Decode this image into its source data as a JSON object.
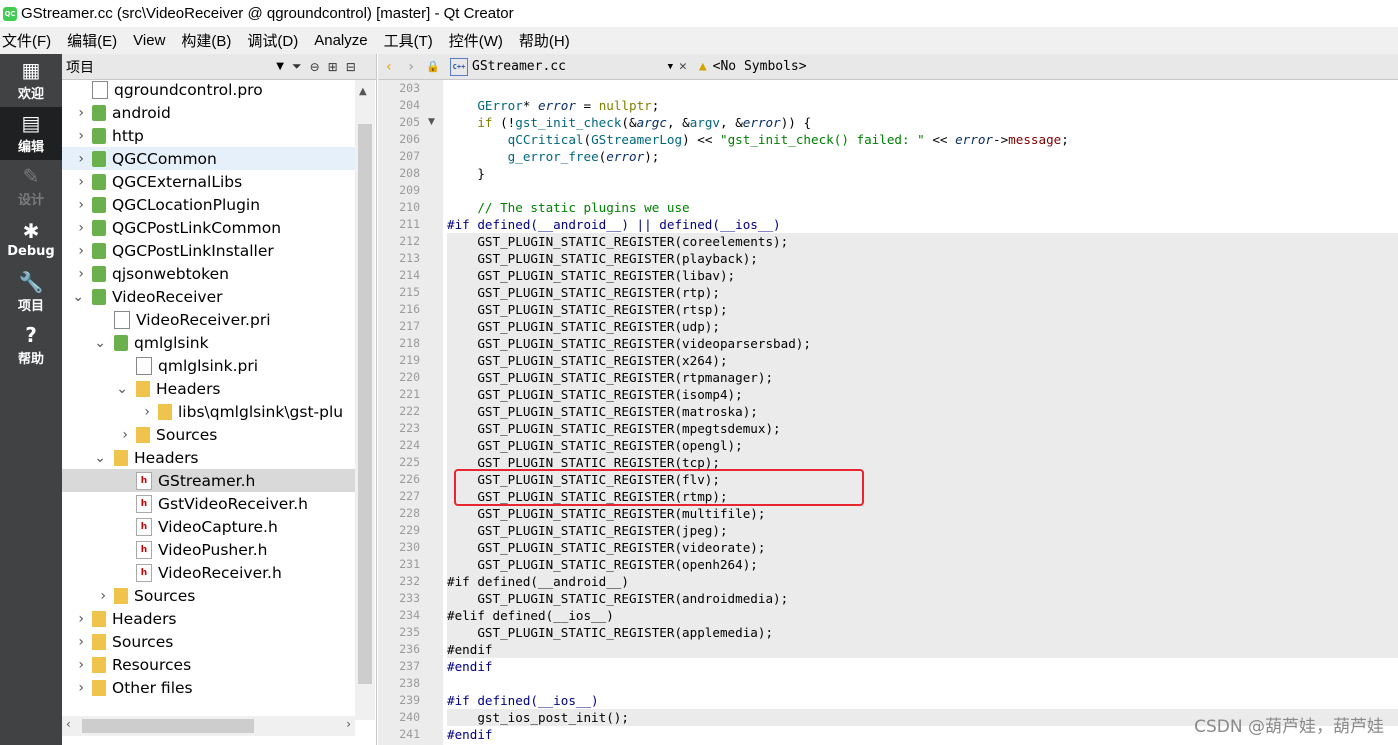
{
  "window": {
    "title": "GStreamer.cc (src\\VideoReceiver @ qgroundcontrol) [master] - Qt Creator",
    "app_icon": "QC"
  },
  "menu": [
    "文件(F)",
    "编辑(E)",
    "View",
    "构建(B)",
    "调试(D)",
    "Analyze",
    "工具(T)",
    "控件(W)",
    "帮助(H)"
  ],
  "modes": [
    {
      "label": "欢迎",
      "icon": "grid-icon",
      "glyph": "▦"
    },
    {
      "label": "编辑",
      "icon": "document-icon",
      "glyph": "▤"
    },
    {
      "label": "设计",
      "icon": "pen-icon",
      "glyph": "✎"
    },
    {
      "label": "Debug",
      "icon": "bug-icon",
      "glyph": "✱"
    },
    {
      "label": "项目",
      "icon": "wrench-icon",
      "glyph": "🔧"
    },
    {
      "label": "帮助",
      "icon": "help-icon",
      "glyph": "?"
    }
  ],
  "project_pane": {
    "title": "项目"
  },
  "tree": [
    {
      "label": "qgroundcontrol.pro",
      "indent": 0,
      "arrow": "",
      "icon": "pro"
    },
    {
      "label": "android",
      "indent": 0,
      "arrow": "›",
      "icon": "proj"
    },
    {
      "label": "http",
      "indent": 0,
      "arrow": "›",
      "icon": "proj"
    },
    {
      "label": "QGCCommon",
      "indent": 0,
      "arrow": "›",
      "icon": "proj",
      "sel": "light"
    },
    {
      "label": "QGCExternalLibs",
      "indent": 0,
      "arrow": "›",
      "icon": "proj"
    },
    {
      "label": "QGCLocationPlugin",
      "indent": 0,
      "arrow": "›",
      "icon": "proj"
    },
    {
      "label": "QGCPostLinkCommon",
      "indent": 0,
      "arrow": "›",
      "icon": "proj"
    },
    {
      "label": "QGCPostLinkInstaller",
      "indent": 0,
      "arrow": "›",
      "icon": "proj"
    },
    {
      "label": "qjsonwebtoken",
      "indent": 0,
      "arrow": "›",
      "icon": "proj"
    },
    {
      "label": "VideoReceiver",
      "indent": 0,
      "arrow": "⌄",
      "icon": "proj"
    },
    {
      "label": "VideoReceiver.pri",
      "indent": 1,
      "arrow": "",
      "icon": "pro"
    },
    {
      "label": "qmlglsink",
      "indent": 1,
      "arrow": "⌄",
      "icon": "proj"
    },
    {
      "label": "qmlglsink.pri",
      "indent": 2,
      "arrow": "",
      "icon": "pro"
    },
    {
      "label": "Headers",
      "indent": 2,
      "arrow": "⌄",
      "icon": "folder"
    },
    {
      "label": "libs\\qmlglsink\\gst-plu",
      "indent": 3,
      "arrow": "›",
      "icon": "folder"
    },
    {
      "label": "Sources",
      "indent": 2,
      "arrow": "›",
      "icon": "folder"
    },
    {
      "label": "Headers",
      "indent": 1,
      "arrow": "⌄",
      "icon": "folder"
    },
    {
      "label": "GStreamer.h",
      "indent": 2,
      "arrow": "",
      "icon": "h",
      "sel": "gray"
    },
    {
      "label": "GstVideoReceiver.h",
      "indent": 2,
      "arrow": "",
      "icon": "h"
    },
    {
      "label": "VideoCapture.h",
      "indent": 2,
      "arrow": "",
      "icon": "h"
    },
    {
      "label": "VideoPusher.h",
      "indent": 2,
      "arrow": "",
      "icon": "h"
    },
    {
      "label": "VideoReceiver.h",
      "indent": 2,
      "arrow": "",
      "icon": "h"
    },
    {
      "label": "Sources",
      "indent": 1,
      "arrow": "›",
      "icon": "folder"
    },
    {
      "label": "Headers",
      "indent": 0,
      "arrow": "›",
      "icon": "folder"
    },
    {
      "label": "Sources",
      "indent": 0,
      "arrow": "›",
      "icon": "folder"
    },
    {
      "label": "Resources",
      "indent": 0,
      "arrow": "›",
      "icon": "folder"
    },
    {
      "label": "Other files",
      "indent": 0,
      "arrow": "›",
      "icon": "folder"
    }
  ],
  "editor": {
    "filename": "GStreamer.cc",
    "file_icon": "C++",
    "symbols": "<No Symbols>"
  },
  "code": [
    {
      "n": "203",
      "html": ""
    },
    {
      "n": "204",
      "html": "    <span class='fn'>GError</span>* <span class='it'>error</span> = <span class='kw'>nullptr</span>;"
    },
    {
      "n": "205",
      "fold": true,
      "html": "    <span class='kw'>if</span> (!<span class='fn'>gst_init_check</span>(&amp;<span class='it'>argc</span>, &amp;<span class='fn'>argv</span>, &amp;<span class='it'>error</span>)) {"
    },
    {
      "n": "206",
      "html": "        <span class='fn'>qCCritical</span>(<span class='fn'>GStreamerLog</span>) &lt;&lt; <span class='str'>\"gst_init_check() failed: \"</span> &lt;&lt; <span class='it'>error</span>-&gt;<span class='mem'>message</span>;"
    },
    {
      "n": "207",
      "html": "        <span class='fn'>g_error_free</span>(<span class='it'>error</span>);"
    },
    {
      "n": "208",
      "html": "    }"
    },
    {
      "n": "209",
      "html": ""
    },
    {
      "n": "210",
      "html": "    <span class='cmt'>// The static plugins we use</span>"
    },
    {
      "n": "211",
      "html": "<span class='pp'>#if defined(__android__) || defined(__ios__)</span>"
    },
    {
      "n": "212",
      "gray": true,
      "html": "    GST_PLUGIN_STATIC_REGISTER(coreelements);"
    },
    {
      "n": "213",
      "gray": true,
      "html": "    GST_PLUGIN_STATIC_REGISTER(playback);"
    },
    {
      "n": "214",
      "gray": true,
      "html": "    GST_PLUGIN_STATIC_REGISTER(libav);"
    },
    {
      "n": "215",
      "gray": true,
      "html": "    GST_PLUGIN_STATIC_REGISTER(rtp);"
    },
    {
      "n": "216",
      "gray": true,
      "html": "    GST_PLUGIN_STATIC_REGISTER(rtsp);"
    },
    {
      "n": "217",
      "gray": true,
      "html": "    GST_PLUGIN_STATIC_REGISTER(udp);"
    },
    {
      "n": "218",
      "gray": true,
      "html": "    GST_PLUGIN_STATIC_REGISTER(videoparsersbad);"
    },
    {
      "n": "219",
      "gray": true,
      "html": "    GST_PLUGIN_STATIC_REGISTER(x264);"
    },
    {
      "n": "220",
      "gray": true,
      "html": "    GST_PLUGIN_STATIC_REGISTER(rtpmanager);"
    },
    {
      "n": "221",
      "gray": true,
      "html": "    GST_PLUGIN_STATIC_REGISTER(isomp4);"
    },
    {
      "n": "222",
      "gray": true,
      "html": "    GST_PLUGIN_STATIC_REGISTER(matroska);"
    },
    {
      "n": "223",
      "gray": true,
      "html": "    GST_PLUGIN_STATIC_REGISTER(mpegtsdemux);"
    },
    {
      "n": "224",
      "gray": true,
      "html": "    GST_PLUGIN_STATIC_REGISTER(opengl);"
    },
    {
      "n": "225",
      "gray": true,
      "html": "    GST_PLUGIN_STATIC_REGISTER(tcp);"
    },
    {
      "n": "226",
      "gray": true,
      "html": "    GST_PLUGIN_STATIC_REGISTER(flv);"
    },
    {
      "n": "227",
      "gray": true,
      "html": "    GST_PLUGIN_STATIC_REGISTER(rtmp);"
    },
    {
      "n": "228",
      "gray": true,
      "html": "    GST_PLUGIN_STATIC_REGISTER(multifile);"
    },
    {
      "n": "229",
      "gray": true,
      "html": "    GST_PLUGIN_STATIC_REGISTER(jpeg);"
    },
    {
      "n": "230",
      "gray": true,
      "html": "    GST_PLUGIN_STATIC_REGISTER(videorate);"
    },
    {
      "n": "231",
      "gray": true,
      "html": "    GST_PLUGIN_STATIC_REGISTER(openh264);"
    },
    {
      "n": "232",
      "gray": true,
      "html": "#if defined(__android__)"
    },
    {
      "n": "233",
      "gray": true,
      "html": "    GST_PLUGIN_STATIC_REGISTER(androidmedia);"
    },
    {
      "n": "234",
      "gray": true,
      "html": "#elif defined(__ios__)"
    },
    {
      "n": "235",
      "gray": true,
      "html": "    GST_PLUGIN_STATIC_REGISTER(applemedia);"
    },
    {
      "n": "236",
      "gray": true,
      "html": "#endif"
    },
    {
      "n": "237",
      "html": "<span class='pp'>#endif</span>"
    },
    {
      "n": "238",
      "html": ""
    },
    {
      "n": "239",
      "html": "<span class='pp'>#if defined(__ios__)</span>"
    },
    {
      "n": "240",
      "gray": true,
      "html": "    gst_ios_post_init();"
    },
    {
      "n": "241",
      "html": "<span class='pp'>#endif</span>"
    }
  ],
  "watermark": "CSDN @葫芦娃，葫芦娃"
}
